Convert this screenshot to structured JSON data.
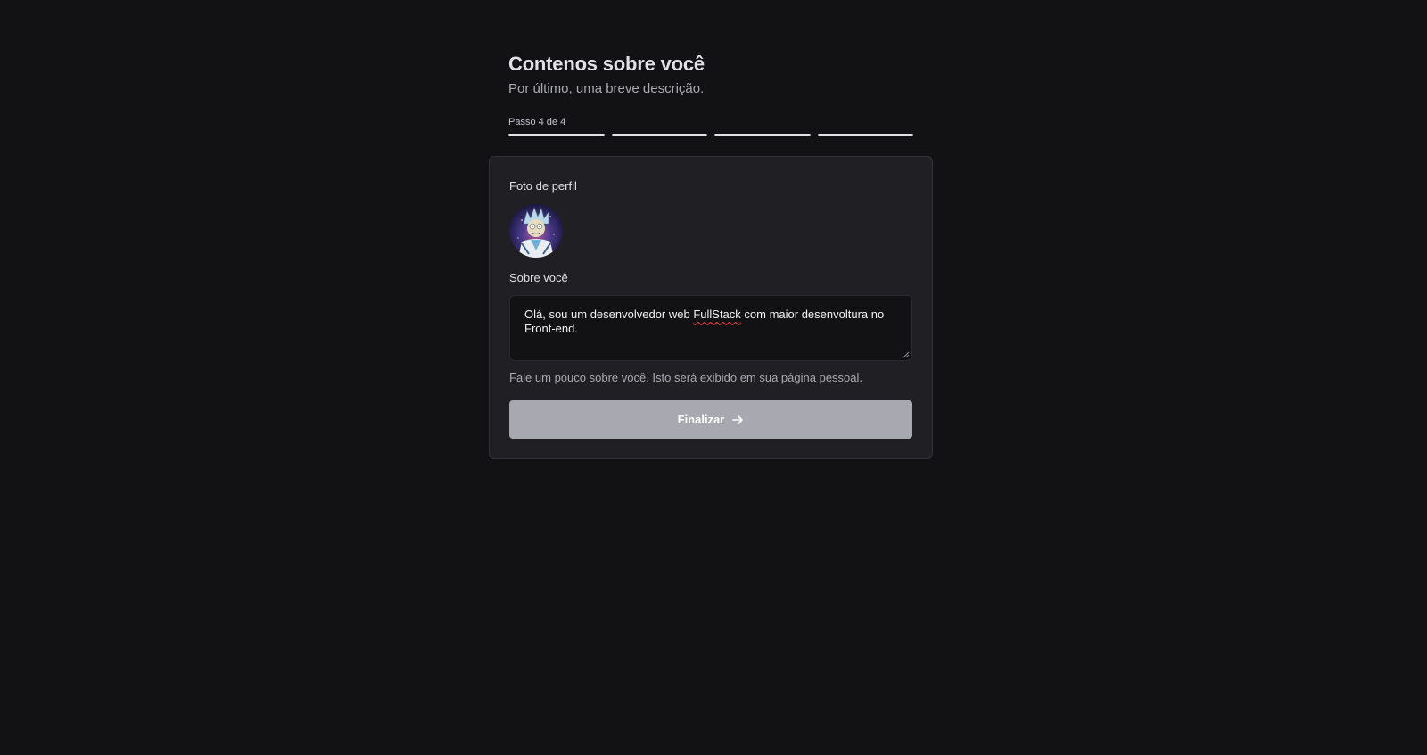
{
  "header": {
    "title": "Contenos sobre você",
    "subtitle": "Por último, uma breve descrição.",
    "step_text": "Passo 4 de 4",
    "steps_total": 4,
    "steps_completed": 4
  },
  "form": {
    "profile_photo_label": "Foto de perfil",
    "avatar_icon": "user-avatar-icon",
    "about_label": "Sobre você",
    "about_value_before": "Olá, sou um desenvolvedor web ",
    "about_value_misspelled": "FullStack",
    "about_value_after": " com maior desenvoltura no Front-end.",
    "about_help": "Fale um pouco sobre você. Isto será exibido em sua página pessoal.",
    "submit_label": "Finalizar",
    "submit_icon": "arrow-right-icon"
  },
  "colors": {
    "background": "#121214",
    "card": "#202024",
    "button_disabled": "#a8a8b0",
    "step_bar": "#e1e1e6"
  }
}
